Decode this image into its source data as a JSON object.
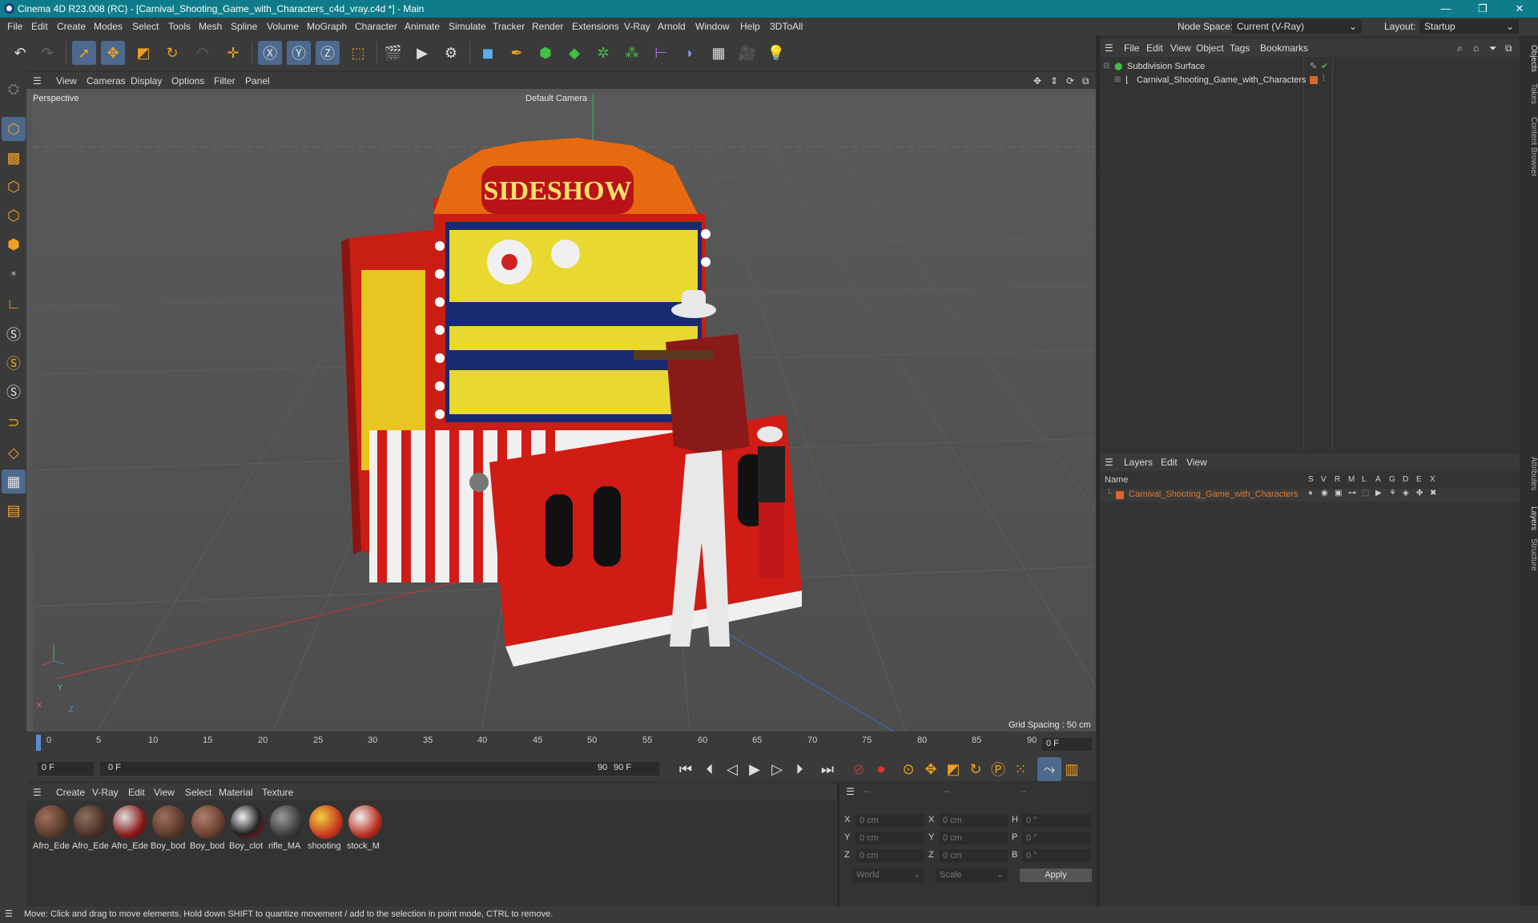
{
  "window": {
    "title": "Cinema 4D R23.008 (RC) - [Carnival_Shooting_Game_with_Characters_c4d_vray.c4d *] - Main",
    "minimize": "—",
    "maximize": "❐",
    "close": "✕"
  },
  "menu": {
    "items": [
      "File",
      "Edit",
      "Create",
      "Modes",
      "Select",
      "Tools",
      "Mesh",
      "Spline",
      "Volume",
      "MoGraph",
      "Character",
      "Animate",
      "Simulate",
      "Tracker",
      "Render",
      "Extensions",
      "V-Ray",
      "Arnold",
      "Window",
      "Help",
      "3DToAll"
    ],
    "node_space_label": "Node Space:",
    "node_space_value": "Current (V-Ray)",
    "layout_label": "Layout:",
    "layout_value": "Startup"
  },
  "viewport": {
    "menu": [
      "View",
      "Cameras",
      "Display",
      "Options",
      "Filter",
      "Panel"
    ],
    "view_name": "Perspective",
    "camera": "Default Camera",
    "grid_spacing": "Grid Spacing : 50 cm"
  },
  "timeline": {
    "ticks": [
      "0",
      "5",
      "10",
      "15",
      "20",
      "25",
      "30",
      "35",
      "40",
      "45",
      "50",
      "55",
      "60",
      "65",
      "70",
      "75",
      "80",
      "85",
      "90"
    ],
    "current_frame": "0 F",
    "start": "0 F",
    "range_start": "0 F",
    "range_end": "90 F",
    "end": "90 F"
  },
  "materials": {
    "menu": [
      "Create",
      "V-Ray",
      "Edit",
      "View",
      "Select",
      "Material",
      "Texture"
    ],
    "items": [
      {
        "name": "Afro_Ede",
        "color": "#5a3a2a"
      },
      {
        "name": "Afro_Ede",
        "color": "#4a3028"
      },
      {
        "name": "Afro_Ede",
        "color": "#8a1a1a"
      },
      {
        "name": "Boy_bod",
        "color": "#5a3828"
      },
      {
        "name": "Boy_bod",
        "color": "#6a4030"
      },
      {
        "name": "Boy_clot",
        "color": "#222222"
      },
      {
        "name": "rifle_MA",
        "color": "#3a3a3a"
      },
      {
        "name": "shooting",
        "color": "#c83a20"
      },
      {
        "name": "stock_M",
        "color": "#b83020"
      }
    ]
  },
  "coords": {
    "headers": [
      "--",
      "--",
      "--"
    ],
    "rows": [
      {
        "a": "X",
        "av": "0 cm",
        "b": "X",
        "bv": "0 cm",
        "c": "H",
        "cv": "0 °"
      },
      {
        "a": "Y",
        "av": "0 cm",
        "b": "Y",
        "bv": "0 cm",
        "c": "P",
        "cv": "0 °"
      },
      {
        "a": "Z",
        "av": "0 cm",
        "b": "Z",
        "bv": "0 cm",
        "c": "B",
        "cv": "0 °"
      }
    ],
    "world": "World",
    "scale": "Scale",
    "apply": "Apply"
  },
  "objects": {
    "menu": [
      "File",
      "Edit",
      "View",
      "Object",
      "Tags",
      "Bookmarks"
    ],
    "tree": [
      "Subdivision Surface",
      "Carnival_Shooting_Game_with_Characters"
    ]
  },
  "layers": {
    "menu": [
      "Layers",
      "Edit",
      "View"
    ],
    "col_name": "Name",
    "flags": [
      "S",
      "V",
      "R",
      "M",
      "L",
      "A",
      "G",
      "D",
      "E",
      "X"
    ],
    "row": "Carnival_Shooting_Game_with_Characters",
    "row_color": "#d9682a"
  },
  "right_tabs": [
    "Objects",
    "Takes",
    "Content Browser",
    "Attributes",
    "Layers",
    "Structure"
  ],
  "status": "Move: Click and drag to move elements. Hold down SHIFT to quantize movement / add to the selection in point mode, CTRL to remove."
}
